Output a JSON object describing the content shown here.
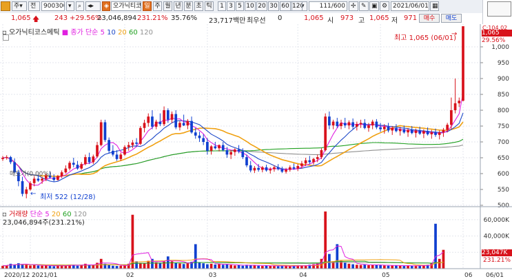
{
  "toolbar": {
    "type_select": "주",
    "type_jeon": "전",
    "code": "900300",
    "name": "오가닉티코",
    "periods": [
      "일",
      "주",
      "월",
      "년",
      "분",
      "초",
      "틱"
    ],
    "intervals": [
      "1",
      "3",
      "5",
      "10",
      "20",
      "30",
      "60",
      "120"
    ],
    "count": "111/600",
    "date": "2021/06/01"
  },
  "quote": {
    "price": "1,065",
    "change": "243",
    "change_pct": "+29.56%",
    "volume": "23,046,894",
    "vol_ratio": "231.21%",
    "turnover": "35.76%",
    "amount": "23,717백만",
    "prefer_label": "최우선",
    "prefer_value": "0",
    "quote_price": "1,065",
    "open_label": "시",
    "open": "973",
    "high_label": "고",
    "high": "1,065",
    "low_label": "저",
    "low": "971",
    "buy_label": "매수",
    "sell_label": "매도"
  },
  "price_panel": {
    "legend_name": "오가닉티코스메틱",
    "legend_ma_label": "종가 단순",
    "ma_periods": [
      "5",
      "10",
      "20",
      "60",
      "120"
    ],
    "high_annotation": "최고 1,065 (06/01)",
    "low_annotation": "최저 522 (12/28)",
    "avg_annotation": "매도가(0.00%)",
    "last_price_label": "1,065",
    "last_pct_label": "29.56%",
    "top_label": "C:104.02"
  },
  "volume_panel": {
    "legend_label": "거래량",
    "legend_ma_label": "단순",
    "ma_periods": [
      "5",
      "20",
      "60",
      "120"
    ],
    "value_text": "23,046,894주(231.21%)",
    "last_vol_label": "23,047K",
    "last_pct_label": "231.21%"
  },
  "colors": {
    "up": "#d8121b",
    "down": "#1040d0",
    "ma5": "#e020e0",
    "ma10": "#1c48c8",
    "ma20": "#f0a010",
    "ma60": "#20a020",
    "ma120": "#909090"
  },
  "chart_data": {
    "type": "candlestick",
    "price_ticks": [
      "1,000",
      "950",
      "900",
      "850",
      "800",
      "750",
      "700",
      "650",
      "600",
      "550",
      "500"
    ],
    "price_ylim": [
      500,
      1050
    ],
    "volume_ticks": [
      "60,000K",
      "40,000K",
      "20,000K"
    ],
    "volume_ylim": [
      0,
      70000
    ],
    "x_labels": [
      {
        "label": "2020/12",
        "i": 0
      },
      {
        "label": "2021/01",
        "i": 7
      },
      {
        "label": "02",
        "i": 31
      },
      {
        "label": "03",
        "i": 52
      },
      {
        "label": "04",
        "i": 75
      },
      {
        "label": "05",
        "i": 96
      },
      {
        "label": "06",
        "i": 117
      },
      {
        "label": "06/01",
        "i": 126
      }
    ],
    "candles": [
      [
        646,
        656,
        640,
        650
      ],
      [
        650,
        658,
        644,
        652
      ],
      [
        652,
        656,
        630,
        636
      ],
      [
        636,
        648,
        600,
        604
      ],
      [
        604,
        612,
        560,
        576
      ],
      [
        576,
        590,
        528,
        536
      ],
      [
        536,
        558,
        522,
        550
      ],
      [
        550,
        576,
        546,
        570
      ],
      [
        570,
        592,
        560,
        584
      ],
      [
        584,
        598,
        574,
        578
      ],
      [
        578,
        590,
        568,
        584
      ],
      [
        584,
        600,
        576,
        594
      ],
      [
        594,
        606,
        584,
        588
      ],
      [
        588,
        598,
        574,
        580
      ],
      [
        580,
        596,
        578,
        592
      ],
      [
        592,
        610,
        586,
        604
      ],
      [
        604,
        626,
        600,
        616
      ],
      [
        616,
        640,
        610,
        634
      ],
      [
        634,
        650,
        620,
        628
      ],
      [
        628,
        640,
        612,
        616
      ],
      [
        616,
        636,
        612,
        630
      ],
      [
        630,
        660,
        626,
        652
      ],
      [
        652,
        666,
        630,
        636
      ],
      [
        636,
        660,
        630,
        654
      ],
      [
        654,
        700,
        650,
        690
      ],
      [
        690,
        770,
        686,
        762
      ],
      [
        762,
        770,
        700,
        706
      ],
      [
        706,
        714,
        664,
        672
      ],
      [
        672,
        690,
        654,
        660
      ],
      [
        660,
        674,
        640,
        646
      ],
      [
        646,
        666,
        640,
        660
      ],
      [
        660,
        690,
        656,
        684
      ],
      [
        684,
        700,
        672,
        690
      ],
      [
        690,
        706,
        680,
        698
      ],
      [
        698,
        712,
        684,
        694
      ],
      [
        694,
        750,
        690,
        744
      ],
      [
        744,
        770,
        730,
        760
      ],
      [
        760,
        790,
        748,
        780
      ],
      [
        780,
        800,
        740,
        748
      ],
      [
        748,
        770,
        740,
        764
      ],
      [
        764,
        790,
        750,
        756
      ],
      [
        756,
        812,
        750,
        800
      ],
      [
        800,
        806,
        760,
        770
      ],
      [
        770,
        796,
        760,
        788
      ],
      [
        788,
        800,
        740,
        746
      ],
      [
        746,
        766,
        736,
        760
      ],
      [
        760,
        786,
        750,
        752
      ],
      [
        752,
        772,
        740,
        766
      ],
      [
        766,
        780,
        726,
        730
      ],
      [
        730,
        744,
        710,
        720
      ],
      [
        720,
        732,
        700,
        712
      ],
      [
        712,
        724,
        690,
        700
      ],
      [
        700,
        712,
        660,
        672
      ],
      [
        672,
        690,
        660,
        686
      ],
      [
        686,
        700,
        676,
        680
      ],
      [
        680,
        692,
        670,
        690
      ],
      [
        690,
        700,
        670,
        674
      ],
      [
        674,
        684,
        650,
        660
      ],
      [
        660,
        674,
        646,
        668
      ],
      [
        668,
        680,
        656,
        676
      ],
      [
        676,
        690,
        664,
        670
      ],
      [
        670,
        680,
        646,
        652
      ],
      [
        652,
        660,
        620,
        626
      ],
      [
        626,
        640,
        604,
        610
      ],
      [
        610,
        624,
        602,
        618
      ],
      [
        618,
        630,
        606,
        612
      ],
      [
        612,
        624,
        604,
        620
      ],
      [
        620,
        628,
        606,
        610
      ],
      [
        610,
        620,
        600,
        614
      ],
      [
        614,
        626,
        606,
        620
      ],
      [
        620,
        630,
        610,
        614
      ],
      [
        614,
        622,
        602,
        606
      ],
      [
        606,
        618,
        600,
        612
      ],
      [
        612,
        626,
        606,
        620
      ],
      [
        620,
        632,
        612,
        616
      ],
      [
        616,
        630,
        608,
        624
      ],
      [
        624,
        640,
        616,
        632
      ],
      [
        632,
        650,
        624,
        642
      ],
      [
        642,
        656,
        630,
        636
      ],
      [
        636,
        650,
        628,
        646
      ],
      [
        646,
        660,
        636,
        652
      ],
      [
        652,
        680,
        646,
        674
      ],
      [
        674,
        790,
        670,
        780
      ],
      [
        780,
        796,
        740,
        752
      ],
      [
        752,
        770,
        740,
        764
      ],
      [
        764,
        776,
        744,
        750
      ],
      [
        750,
        770,
        740,
        760
      ],
      [
        760,
        776,
        744,
        752
      ],
      [
        752,
        768,
        740,
        762
      ],
      [
        762,
        774,
        740,
        748
      ],
      [
        748,
        764,
        736,
        756
      ],
      [
        756,
        770,
        744,
        760
      ],
      [
        760,
        772,
        740,
        744
      ],
      [
        744,
        760,
        732,
        752
      ],
      [
        752,
        770,
        740,
        764
      ],
      [
        764,
        772,
        740,
        746
      ],
      [
        746,
        760,
        732,
        740
      ],
      [
        740,
        756,
        726,
        748
      ],
      [
        748,
        760,
        730,
        736
      ],
      [
        736,
        750,
        722,
        744
      ],
      [
        744,
        756,
        730,
        734
      ],
      [
        734,
        748,
        720,
        740
      ],
      [
        740,
        752,
        726,
        730
      ],
      [
        730,
        744,
        716,
        738
      ],
      [
        738,
        750,
        724,
        728
      ],
      [
        728,
        742,
        714,
        736
      ],
      [
        736,
        748,
        722,
        726
      ],
      [
        726,
        740,
        712,
        734
      ],
      [
        734,
        746,
        720,
        724
      ],
      [
        724,
        738,
        710,
        730
      ],
      [
        730,
        742,
        716,
        722
      ],
      [
        722,
        736,
        708,
        730
      ],
      [
        730,
        744,
        716,
        738
      ],
      [
        738,
        760,
        730,
        754
      ],
      [
        754,
        840,
        740,
        800
      ],
      [
        800,
        900,
        790,
        822
      ],
      [
        822,
        840,
        810,
        830
      ],
      [
        830,
        1065,
        828,
        1065
      ]
    ],
    "volumes": [
      3500,
      4200,
      6000,
      5200,
      6600,
      5400,
      4800,
      3900,
      4500,
      3800,
      3600,
      4200,
      3300,
      3000,
      3600,
      3900,
      4200,
      4800,
      4500,
      3600,
      4200,
      6000,
      4800,
      4500,
      7200,
      12000,
      6000,
      4500,
      3600,
      3300,
      3600,
      4200,
      6000,
      66000,
      9000,
      7200,
      6600,
      9600,
      12000,
      7800,
      6900,
      8700,
      15000,
      9000,
      7200,
      6300,
      5700,
      6600,
      8400,
      30000,
      7800,
      6600,
      5400,
      6000,
      5100,
      6000,
      4800,
      5400,
      4500,
      3900,
      4200,
      3600,
      4800,
      4500,
      3900,
      3600,
      3300,
      3900,
      3600,
      3300,
      3000,
      3600,
      3300,
      3000,
      3600,
      3300,
      3900,
      4200,
      4800,
      5400,
      6600,
      12000,
      70000,
      18000,
      9000,
      30000,
      9600,
      7200,
      6000,
      5400,
      4800,
      4500,
      5100,
      4200,
      4800,
      4500,
      4200,
      3900,
      3600,
      4200,
      3900,
      3600,
      3300,
      3900,
      3600,
      3300,
      3900,
      4200,
      4800,
      6600,
      55000,
      12000,
      23047
    ]
  }
}
